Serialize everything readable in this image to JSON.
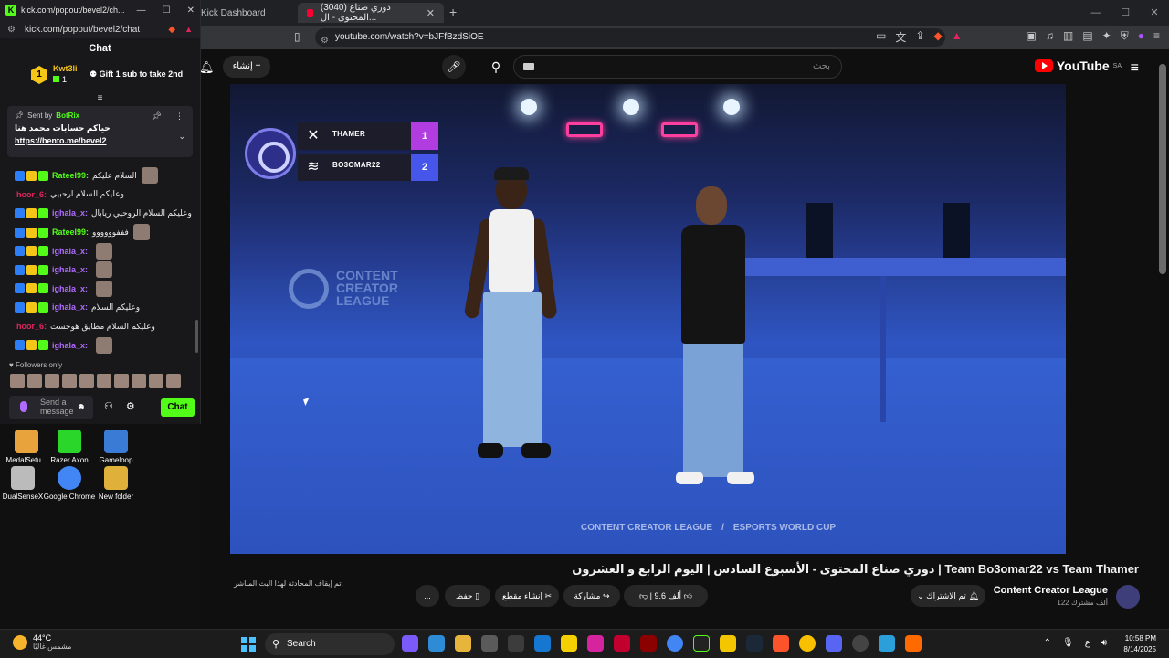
{
  "yt_browser": {
    "tabs": [
      {
        "label": "Kick Dashboard"
      },
      {
        "label": "(3040) دوري صناع المحتوى - ال..."
      }
    ],
    "url": "youtube.com/watch?v=bJFfBzdSiOE",
    "header": {
      "create_label": "إنشاء",
      "search_placeholder": "بحث",
      "logo_text": "YouTube",
      "logo_region": "SA"
    }
  },
  "video": {
    "scoreboard": {
      "team1": "THAMER",
      "score1": "1",
      "team2": "BO3OMAR22",
      "score2": "2"
    },
    "wall_logo": "CONTENT CREATOR LEAGUE",
    "watermark_left": "CONTENT CREATOR LEAGUE",
    "watermark_right": "ESPORTS WORLD CUP",
    "title": "دوري صناع المحتوى - الأسبوع السادس | اليوم الرابع و العشرون | Team Bo3omar22 vs Team Thamer",
    "live_note": "تم إيقاف المحادثة لهذا البث المباشر."
  },
  "channel": {
    "name": "Content Creator League",
    "subs": "122 ألف مشترك",
    "subscribed_label": "تم الاشتراك",
    "like_label": "9.6 ألف",
    "share_label": "مشاركة",
    "clip_label": "إنشاء مقطع",
    "save_label": "حفظ",
    "more_label": "..."
  },
  "kick": {
    "window_title": "kick.com/popout/bevel2/ch...",
    "url": "kick.com/popout/bevel2/chat",
    "panel_title": "Chat",
    "gift": {
      "user": "Kwt3li",
      "count": "1",
      "rank": "1",
      "text": "Gift 1 sub to take 2nd"
    },
    "pinned": {
      "sent_by_label": "Sent by",
      "sender": "BotRix",
      "message": "حياكم حسابات محمد هنا",
      "link": "https://bento.me/bevel2"
    },
    "messages": [
      {
        "user": "Rateel99:",
        "text": "السلام عليكم",
        "color": "#53fc18",
        "badges": 3,
        "emote": true
      },
      {
        "user": "hoor_6:",
        "text": "وعليكم السلام ارحبيي",
        "color": "#e0245e",
        "badges": 0,
        "emote": false
      },
      {
        "user": "ighala_x:",
        "text": "وعليكم السلام الروحيي ريابال",
        "color": "#b06bff",
        "badges": 3,
        "emote": false
      },
      {
        "user": "Rateel99:",
        "text": "فففوووووو",
        "color": "#53fc18",
        "badges": 3,
        "emote": true
      },
      {
        "user": "ighala_x:",
        "text": "",
        "color": "#b06bff",
        "badges": 3,
        "emote": true
      },
      {
        "user": "ighala_x:",
        "text": "",
        "color": "#b06bff",
        "badges": 3,
        "emote": true
      },
      {
        "user": "ighala_x:",
        "text": "",
        "color": "#b06bff",
        "badges": 3,
        "emote": true
      },
      {
        "user": "ighala_x:",
        "text": "وعليكم السلام",
        "color": "#b06bff",
        "badges": 3,
        "emote": false
      },
      {
        "user": "hoor_6:",
        "text": "وعليكم السلام مطايق هوجست",
        "color": "#e0245e",
        "badges": 0,
        "emote": false
      },
      {
        "user": "ighala_x:",
        "text": "",
        "color": "#b06bff",
        "badges": 3,
        "emote": true
      }
    ],
    "followers_only": "Followers only",
    "input_placeholder": "Send a message",
    "chat_button": "Chat"
  },
  "desktop_icons": [
    {
      "label": "MedalSetu...",
      "color": "#e8a33c"
    },
    {
      "label": "Razer Axon",
      "color": "#2bd62b"
    },
    {
      "label": "Gameloop",
      "color": "#3a7bd5"
    },
    {
      "label": "DualSenseX",
      "color": "#bbbbbb"
    },
    {
      "label": "Google Chrome",
      "color": "#4285f4"
    },
    {
      "label": "New folder",
      "color": "#e0b13a"
    }
  ],
  "taskbar": {
    "temp": "44°C",
    "weather": "مشمس غالبًا",
    "search_label": "Search",
    "time": "10:58 PM",
    "date": "8/14/2025",
    "lang": "ع"
  }
}
